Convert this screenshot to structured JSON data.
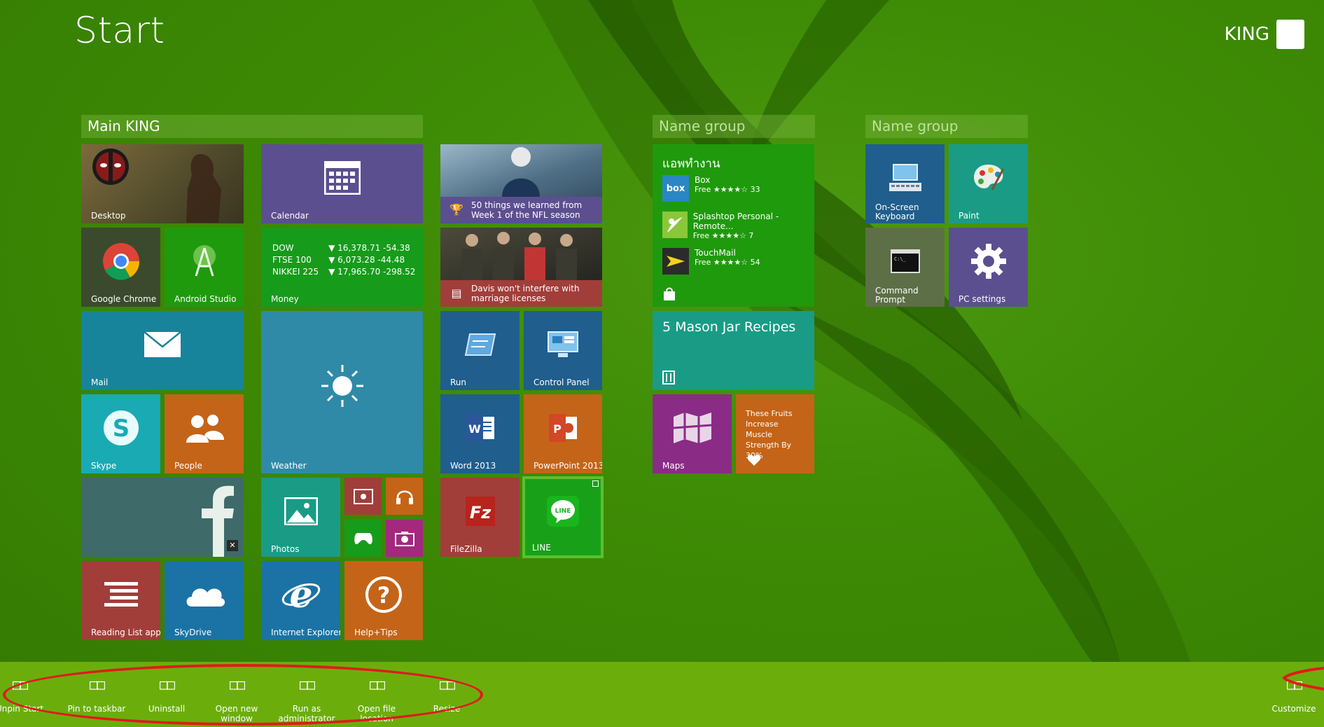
{
  "screen": {
    "title": "Start",
    "user_name": "KING"
  },
  "colors": {
    "accent_bg": "#3f8c06",
    "appbar": "#6bae0c",
    "annotation": "#e01b1b"
  },
  "groups": {
    "main": "Main KING",
    "group2": "Name group",
    "group3": "Name group"
  },
  "tiles": {
    "desktop": "Desktop",
    "calendar": "Calendar",
    "news1": "50 things we learned from Week 1 of the NFL season",
    "news2": "Davis won't interfere with marriage licenses",
    "chrome": "Google Chrome",
    "android_studio": "Android Studio",
    "money": {
      "label": "Money",
      "rows": [
        {
          "index": "DOW",
          "value": "▼ 16,378.71 -54.38"
        },
        {
          "index": "FTSE 100",
          "value": "▼ 6,073.28 -44.48"
        },
        {
          "index": "NIKKEI 225",
          "value": "▼ 17,965.70 -298.52"
        }
      ]
    },
    "mail": "Mail",
    "weather": "Weather",
    "run": "Run",
    "control_panel": "Control Panel",
    "skype": "Skype",
    "people": "People",
    "word": "Word 2013",
    "powerpoint": "PowerPoint 2013",
    "photos": "Photos",
    "filezilla": "FileZilla",
    "line": "LINE",
    "reading_list": "Reading List app",
    "skydrive": "SkyDrive",
    "ie": "Internet Explorer",
    "help": "Help+Tips",
    "store": {
      "title": "แอพทำงาน",
      "apps": [
        {
          "icon": "box",
          "name": "Box",
          "price": "Free ★★★★☆ 33"
        },
        {
          "icon": "",
          "name": "Splashtop Personal - Remote...",
          "price": "Free ★★★★☆ 7"
        },
        {
          "icon": "",
          "name": "TouchMail",
          "price": "Free ★★★★☆ 54"
        }
      ]
    },
    "recipes": "5 Mason Jar Recipes",
    "maps": "Maps",
    "fruits": "These Fruits Increase Muscle Strength By 30%",
    "osk": "On-Screen Keyboard",
    "paint": "Paint",
    "cmd": "Command Prompt",
    "pc_settings": "PC settings"
  },
  "appbar": {
    "icon_glyph": "□□",
    "commands": [
      {
        "label": "Unpin"
      },
      {
        "label": "Start"
      },
      {
        "label": "Pin to taskbar"
      },
      {
        "label": "Uninstall"
      },
      {
        "label": "Open new window"
      },
      {
        "label": "Run as administrator"
      },
      {
        "label": "Open file location"
      },
      {
        "label": "Resize"
      }
    ],
    "customize": "Customize"
  }
}
